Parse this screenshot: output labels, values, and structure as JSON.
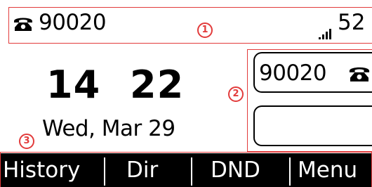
{
  "status_bar": {
    "account_number": "90020",
    "right_text": "52",
    "icons": [
      "phone-icon",
      "signal-strength-icon"
    ]
  },
  "clock": {
    "hours": "14",
    "minutes": "22",
    "date": "Wed, Mar 29"
  },
  "line_keys": [
    {
      "label": "90020",
      "icon": "phone-icon"
    },
    {
      "label": "",
      "icon": ""
    }
  ],
  "softkeys": [
    {
      "label": "History"
    },
    {
      "label": "Dir"
    },
    {
      "label": "DND"
    },
    {
      "label": "Menu"
    }
  ],
  "annotations": {
    "marker_1": "1",
    "marker_2": "2",
    "marker_3": "3"
  },
  "colors": {
    "annotation": "#e23b3b",
    "softkey_bar": "#000000",
    "softkey_text": "#ffffff",
    "background": "#ffffff"
  }
}
